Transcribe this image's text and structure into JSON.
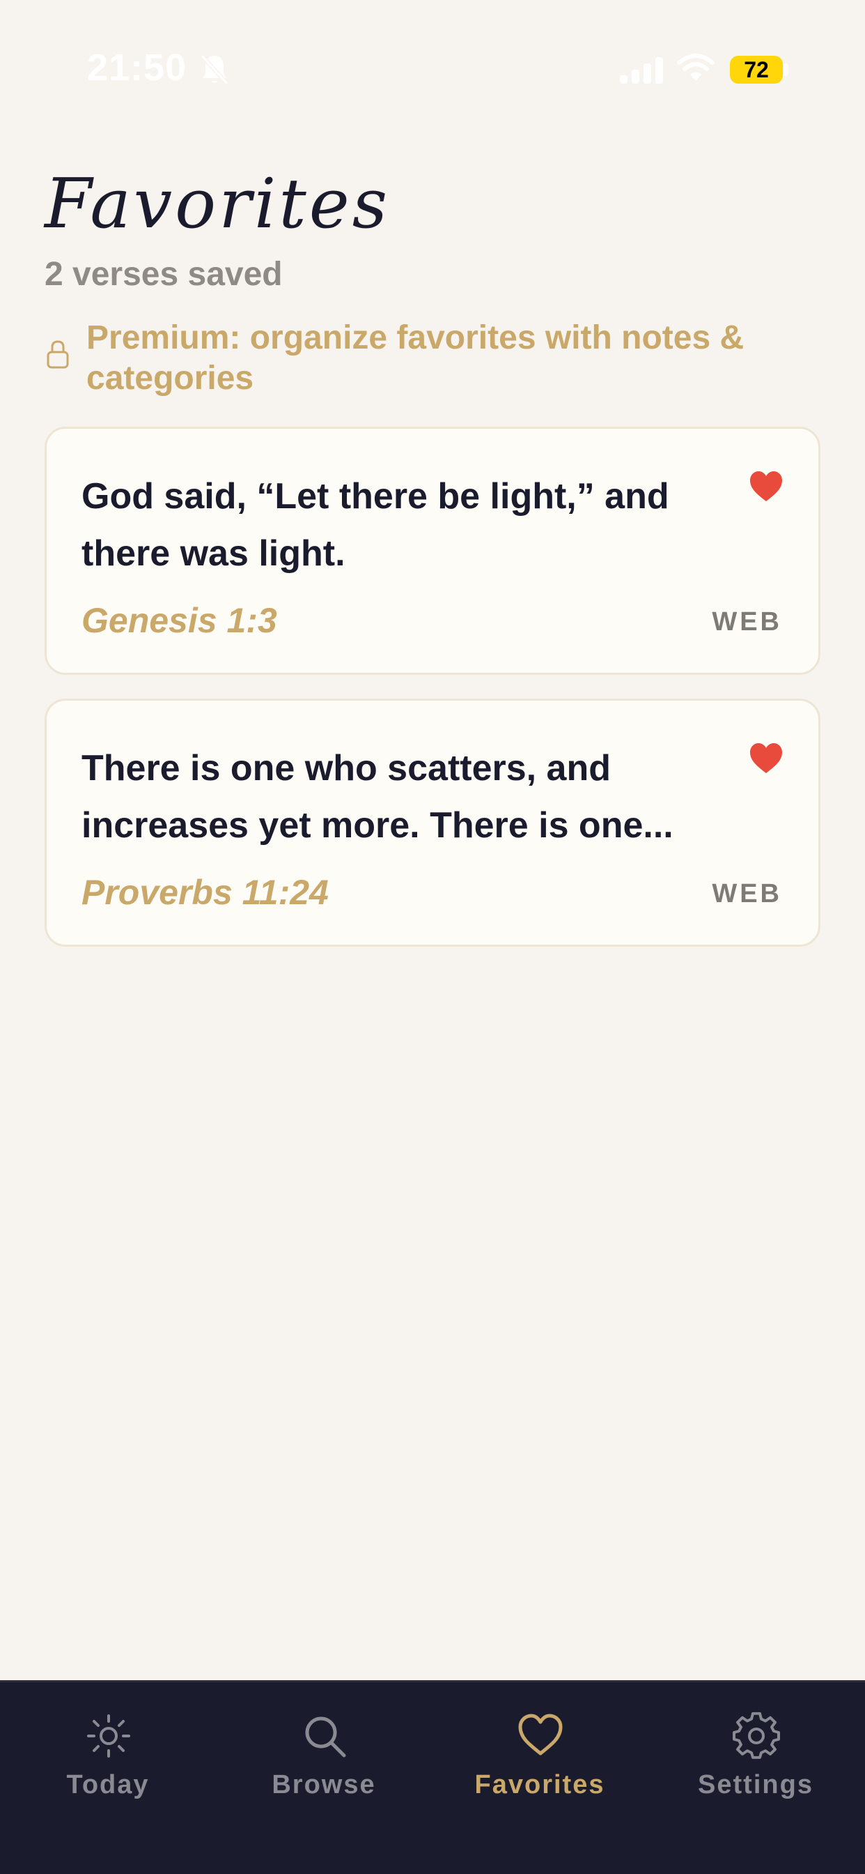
{
  "status_bar": {
    "time": "21:50",
    "battery": "72"
  },
  "header": {
    "title": "Favorites",
    "subtitle": "2 verses saved",
    "premium_note": "Premium: organize favorites with notes & categories"
  },
  "favorites": [
    {
      "text": "God said, “Let there be light,” and there was light.",
      "reference": "Genesis 1:3",
      "translation": "WEB",
      "favorited": true
    },
    {
      "text": "There is one who scatters, and increases yet more. There is one...",
      "reference": "Proverbs 11:24",
      "translation": "WEB",
      "favorited": true
    }
  ],
  "tabs": [
    {
      "label": "Today",
      "icon": "sun-icon",
      "active": false
    },
    {
      "label": "Browse",
      "icon": "search-icon",
      "active": false
    },
    {
      "label": "Favorites",
      "icon": "heart-icon",
      "active": true
    },
    {
      "label": "Settings",
      "icon": "gear-icon",
      "active": false
    }
  ],
  "colors": {
    "background": "#f7f3ee",
    "accent_gold": "#c9a86a",
    "heart_red": "#e84a3c",
    "tab_bar": "#1b1b2e",
    "battery": "#ffd60a"
  }
}
